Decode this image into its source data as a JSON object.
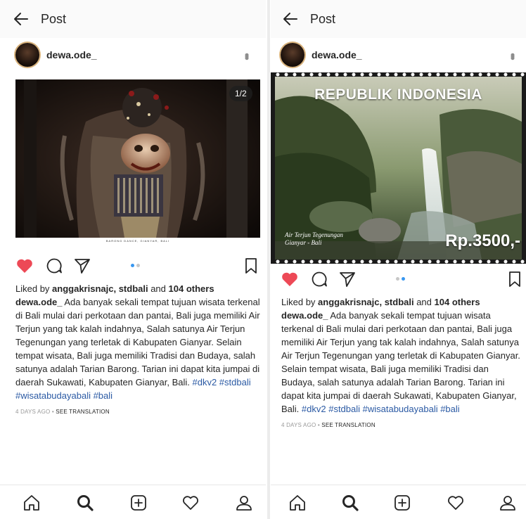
{
  "posts": [
    {
      "header": {
        "title": "Post"
      },
      "user": {
        "username": "dewa.ode_"
      },
      "image": {
        "counter": "1/2",
        "caption": "BARONG DANCE, GIANYAR, BALI"
      },
      "likes": {
        "prefix": "Liked by ",
        "users": "anggakrisnajc, stdbali",
        "mid": " and ",
        "count": "104 others"
      },
      "caption": {
        "author": "dewa.ode_",
        "body": " Ada banyak sekali tempat tujuan wisata terkenal di Bali mulai dari perkotaan dan pantai, Bali juga memiliki Air Terjun yang tak kalah indahnya, Salah satunya Air Terjun Tegenungan yang terletak di Kabupaten Gianyar. Selain tempat wisata, Bali juga memiliki Tradisi dan Budaya, salah satunya adalah Tarian Barong. Tarian ini dapat kita jumpai di daerah Sukawati, Kabupaten Gianyar, Bali. ",
        "tags": "#dkv2 #stdbali #wisatabudayabali #bali"
      },
      "meta": {
        "time": "4 DAYS AGO",
        "sep": " • ",
        "translate": "SEE TRANSLATION"
      }
    },
    {
      "header": {
        "title": "Post"
      },
      "user": {
        "username": "dewa.ode_"
      },
      "image": {
        "stamp_title": "REPUBLIK INDONESIA",
        "stamp_price": "Rp.3500,-",
        "stamp_script_1": "Air Terjun Tegenungan",
        "stamp_script_2": "Gianyar - Bali"
      },
      "likes": {
        "prefix": "Liked by ",
        "users": "anggakrisnajc, stdbali",
        "mid": " and ",
        "count": "104 others"
      },
      "caption": {
        "author": "dewa.ode_",
        "body": " Ada banyak sekali tempat tujuan wisata terkenal di Bali mulai dari perkotaan dan pantai, Bali juga memiliki Air Terjun yang tak kalah indahnya, Salah satunya Air Terjun Tegenungan yang terletak di Kabupaten Gianyar. Selain tempat wisata, Bali juga memiliki Tradisi dan Budaya, salah satunya adalah Tarian Barong. Tarian ini dapat kita jumpai di daerah Sukawati, Kabupaten Gianyar, Bali. ",
        "tags": "#dkv2 #stdbali #wisatabudayabali #bali"
      },
      "meta": {
        "time": "4 DAYS AGO",
        "sep": " • ",
        "translate": "SEE TRANSLATION"
      }
    }
  ],
  "colors": {
    "like": "#ed4956",
    "hashtag": "#2b5aa4",
    "dot_active": "#3897f0"
  },
  "icons": [
    "back-arrow-icon",
    "more-icon",
    "heart-icon",
    "comment-icon",
    "share-icon",
    "bookmark-icon",
    "home-icon",
    "search-icon",
    "add-icon",
    "activity-icon",
    "profile-icon"
  ]
}
